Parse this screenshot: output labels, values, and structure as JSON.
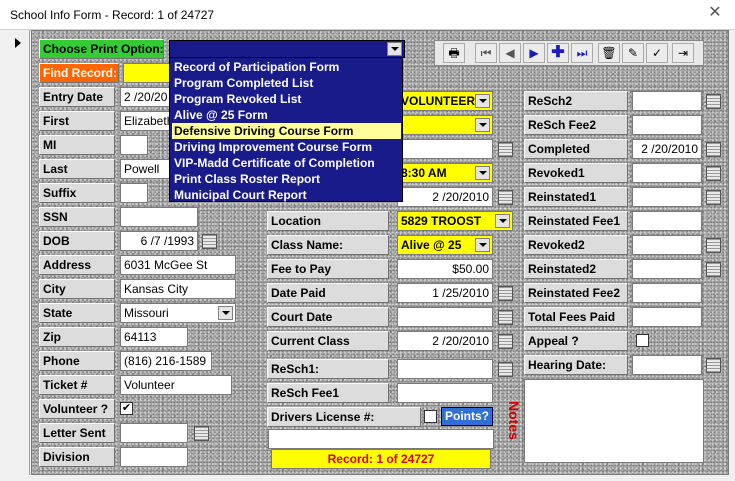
{
  "window": {
    "title": "School Info Form - Record: 1 of 24727"
  },
  "print_option": {
    "label": "Choose Print Option:",
    "options": [
      "Record of Participation Form",
      "Program Completed List",
      "Program Revoked List",
      "Alive @ 25 Form",
      "Defensive Driving Course Form",
      "Driving Improvement Course Form",
      "VIP-Madd Certificate of Completion",
      "Print Class Roster Report",
      "Municipal Court Report"
    ],
    "highlighted": "Defensive Driving Course Form"
  },
  "find_record": {
    "label": "Find Record:"
  },
  "left": {
    "entry_date": {
      "label": "Entry Date",
      "value": "2 /20/20"
    },
    "first": {
      "label": "First",
      "value": "Elizabeth"
    },
    "mi": {
      "label": "MI",
      "value": ""
    },
    "last": {
      "label": "Last",
      "value": "Powell"
    },
    "suffix": {
      "label": "Suffix",
      "value": ""
    },
    "ssn": {
      "label": "SSN",
      "value": ""
    },
    "dob": {
      "label": "DOB",
      "value": "6 /7 /1993"
    },
    "address": {
      "label": "Address",
      "value": "6031 McGee St"
    },
    "city": {
      "label": "City",
      "value": "Kansas City"
    },
    "state": {
      "label": "State",
      "value": "Missouri"
    },
    "zip": {
      "label": "Zip",
      "value": "64113"
    },
    "phone": {
      "label": "Phone",
      "value": "(816) 216-1589"
    },
    "ticket": {
      "label": "Ticket #",
      "value": "Volunteer"
    },
    "volunteer": {
      "label": "Volunteer ?",
      "checked": "✔"
    },
    "letter_sent": {
      "label": "Letter Sent",
      "value": ""
    },
    "division": {
      "label": "Division",
      "value": ""
    }
  },
  "middle": {
    "volunteer_value": "VOLUNTEER",
    "time_value": "8:30 AM",
    "date_value": "2 /20/2010",
    "location": {
      "label": "Location",
      "value": "5829 TROOST"
    },
    "class_name": {
      "label": "Class Name:",
      "value": "Alive @ 25"
    },
    "fee_to_pay": {
      "label": "Fee to Pay",
      "value": "$50.00"
    },
    "date_paid": {
      "label": "Date Paid",
      "value": "1 /25/2010"
    },
    "court_date": {
      "label": "Court Date",
      "value": ""
    },
    "current_class": {
      "label": "Current Class",
      "value": "2 /20/2010"
    },
    "resch1": {
      "label": "ReSch1:",
      "value": ""
    },
    "resch_fee1": {
      "label": "ReSch Fee1",
      "value": ""
    },
    "drivers_license": {
      "label": "Drivers License #:"
    },
    "points_button": "Points?",
    "record_footer": "Record: 1 of 24727"
  },
  "right": {
    "resch2": {
      "label": "ReSch2",
      "value": ""
    },
    "resch_fee2": {
      "label": "ReSch Fee2",
      "value": ""
    },
    "completed": {
      "label": "Completed",
      "value": "2 /20/2010"
    },
    "revoked1": {
      "label": "Revoked1",
      "value": ""
    },
    "reinstated1": {
      "label": "Reinstated1",
      "value": ""
    },
    "reinstated_fee1": {
      "label": "Reinstated Fee1",
      "value": ""
    },
    "revoked2": {
      "label": "Revoked2",
      "value": ""
    },
    "reinstated2": {
      "label": "Reinstated2",
      "value": ""
    },
    "reinstated_fee2": {
      "label": "Reinstated Fee2",
      "value": ""
    },
    "total_fees_paid": {
      "label": "Total Fees Paid",
      "value": ""
    },
    "appeal": {
      "label": "Appeal ?"
    },
    "hearing_date": {
      "label": "Hearing Date:",
      "value": ""
    },
    "notes_label": "Notes"
  },
  "colors": {
    "dropdown_bg": "#1a1b8a",
    "highlight": "#ffff99",
    "yellow_field": "#ffff00",
    "find_record_bg": "#ff6600",
    "print_option_bg": "#33cc33",
    "notes_label": "#d40000"
  },
  "toolbar_icons": [
    "printer-icon",
    "first-record-icon",
    "previous-record-icon",
    "next-record-icon",
    "new-record-icon",
    "last-record-icon",
    "delete-icon",
    "edit-icon",
    "spell-check-icon",
    "exit-icon"
  ]
}
